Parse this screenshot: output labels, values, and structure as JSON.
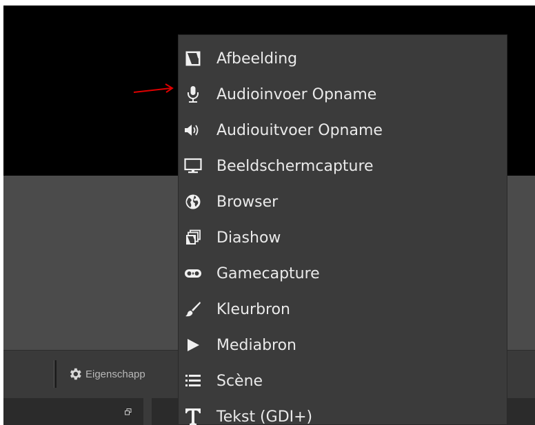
{
  "toolbar": {
    "properties_label": "Eigenschapp"
  },
  "menu": {
    "items": [
      {
        "label": "Afbeelding",
        "icon": "image-icon"
      },
      {
        "label": "Audioinvoer Opname",
        "icon": "microphone-icon"
      },
      {
        "label": "Audiouitvoer Opname",
        "icon": "speaker-icon"
      },
      {
        "label": "Beeldschermcapture",
        "icon": "monitor-icon"
      },
      {
        "label": "Browser",
        "icon": "globe-icon"
      },
      {
        "label": "Diashow",
        "icon": "slideshow-icon"
      },
      {
        "label": "Gamecapture",
        "icon": "gamepad-icon"
      },
      {
        "label": "Kleurbron",
        "icon": "brush-icon"
      },
      {
        "label": "Mediabron",
        "icon": "play-icon"
      },
      {
        "label": "Scène",
        "icon": "list-icon"
      },
      {
        "label": "Tekst (GDI+)",
        "icon": "text-icon"
      }
    ]
  },
  "colors": {
    "menu_background": "#3b3b3b",
    "menu_text": "#eaeaea",
    "preview_background": "#000000",
    "dock_background": "#4b4b4b",
    "annotation_arrow": "#e00000"
  }
}
